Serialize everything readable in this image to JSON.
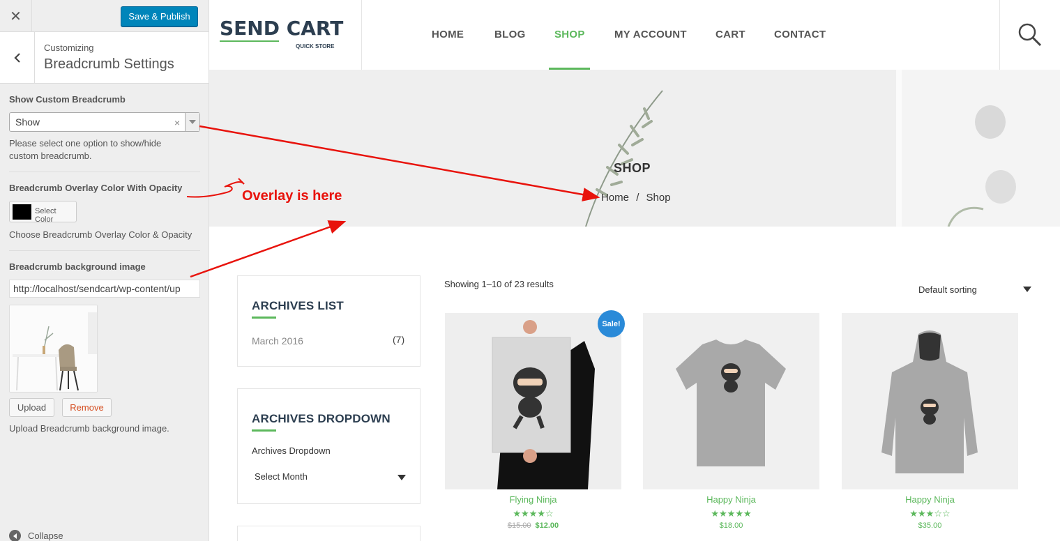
{
  "customizer": {
    "close_icon": "close-icon",
    "publish_label": "Save & Publish",
    "breadcrumb_label": "Customizing",
    "section_title": "Breadcrumb Settings",
    "show_custom": {
      "label": "Show Custom Breadcrumb",
      "value": "Show",
      "clear": "×",
      "description": "Please select one option to show/hide custom breadcrumb."
    },
    "overlay": {
      "label": "Breadcrumb Overlay Color With Opacity",
      "button_label": "Select Color",
      "swatch_color": "#000000",
      "description": "Choose Breadcrumb Overlay Color & Opacity"
    },
    "bg_image": {
      "label": "Breadcrumb background image",
      "url": "http://localhost/sendcart/wp-content/up",
      "upload_label": "Upload",
      "remove_label": "Remove",
      "description": "Upload Breadcrumb background image."
    },
    "collapse_label": "Collapse"
  },
  "site": {
    "logo_text": "SEND CART",
    "logo_tagline": "QUICK STORE",
    "nav": [
      {
        "label": "HOME",
        "active": false
      },
      {
        "label": "BLOG",
        "active": false
      },
      {
        "label": "SHOP",
        "active": true
      },
      {
        "label": "MY ACCOUNT",
        "active": false
      },
      {
        "label": "CART",
        "active": false
      },
      {
        "label": "CONTACT",
        "active": false
      }
    ],
    "accent_color": "#5cb85c",
    "banner": {
      "title": "SHOP",
      "crumb_home": "Home",
      "crumb_sep": "/",
      "crumb_current": "Shop"
    },
    "archives_list": {
      "title": "ARCHIVES LIST",
      "item_label": "March 2016",
      "item_count": "(7)"
    },
    "archives_dropdown": {
      "title": "ARCHIVES DROPDOWN",
      "label": "Archives Dropdown",
      "selected": "Select Month"
    },
    "results_text": "Showing 1–10 of 23 results",
    "sorting_value": "Default sorting",
    "products": [
      {
        "name": "Flying Ninja",
        "rating": 4,
        "old_price": "$15.00",
        "price": "$12.00",
        "sale": "Sale!"
      },
      {
        "name": "Happy Ninja",
        "rating": 5,
        "old_price": "",
        "price": "$18.00",
        "sale": ""
      },
      {
        "name": "Happy Ninja",
        "rating": 3,
        "old_price": "",
        "price": "$35.00",
        "sale": ""
      }
    ]
  },
  "annotation": {
    "text": "Overlay is here",
    "color": "#e8130c"
  }
}
